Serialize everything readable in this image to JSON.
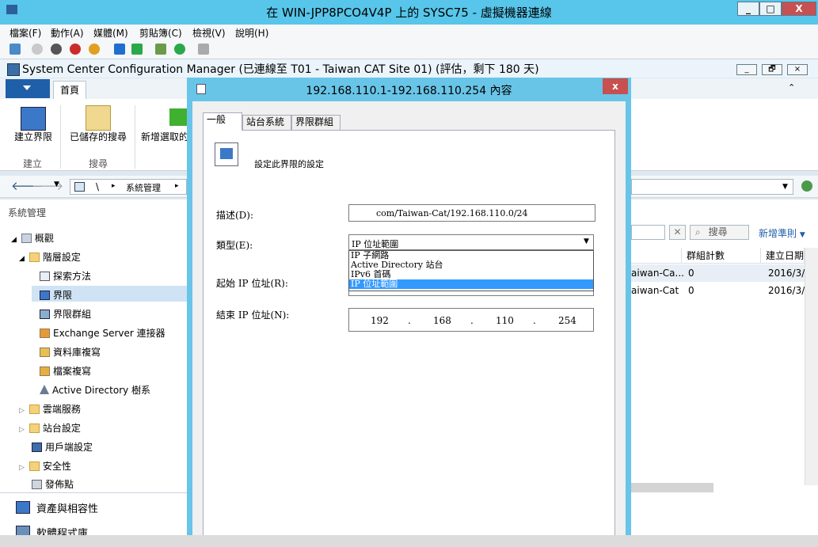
{
  "vm_window": {
    "title": "在 WIN-JPP8PCO4V4P 上的 SYSC75 - 虛擬機器連線",
    "menu": [
      "檔案(F)",
      "動作(A)",
      "媒體(M)",
      "剪貼簿(C)",
      "檢視(V)",
      "說明(H)"
    ],
    "minimize": "_",
    "maximize": "□",
    "close": "X"
  },
  "app": {
    "title": "System Center Configuration Manager (已連線至 T01 - Taiwan CAT Site 01) (評估，剩下 180 天)",
    "minimize": "_",
    "restore": "🗗",
    "close": "×"
  },
  "ribbon": {
    "home_tab": "首頁",
    "buttons": [
      "建立界限",
      "已儲存的搜尋",
      "新增選取的"
    ],
    "groups": [
      "建立",
      "搜尋"
    ]
  },
  "nav": {
    "breadcrumb": [
      "\\",
      "系統管理"
    ]
  },
  "sidebar": {
    "header": "系統管理",
    "items": [
      "概觀",
      "階層設定",
      "探索方法",
      "界限",
      "界限群組",
      "Exchange Server 連接器",
      "資料庫複寫",
      "檔案複寫",
      "Active Directory 樹系",
      "雲端服務",
      "站台設定",
      "用戶端設定",
      "安全性",
      "發佈點"
    ],
    "workspaces": [
      "資產與相容性",
      "軟體程式庫"
    ]
  },
  "content": {
    "search_label": "搜尋",
    "add_criteria": "新增準則",
    "columns": [
      "群組計數",
      "建立日期"
    ],
    "rows": [
      {
        "name": "aiwan-Ca...",
        "count": "0",
        "date": "2016/3/"
      },
      {
        "name": "aiwan-Cat",
        "count": "0",
        "date": "2016/3/"
      }
    ]
  },
  "dialog": {
    "title": "192.168.110.1-192.168.110.254 內容",
    "close": "x",
    "tabs": [
      "一般",
      "站台系統",
      "界限群組"
    ],
    "heading": "設定此界限的設定",
    "description_label": "描述(D):",
    "description_value": "com/Taiwan-Cat/192.168.110.0/24",
    "type_label": "類型(E):",
    "type_selected": "IP 位址範圍",
    "type_options": [
      "IP 子網路",
      "Active Directory 站台",
      "IPv6 首碼",
      "IP 位址範圍"
    ],
    "start_ip_label": "起始 IP 位址(R):",
    "end_ip_label": "結束 IP 位址(N):",
    "end_ip": [
      "192",
      "168",
      "110",
      "254"
    ],
    "ip_dot": "."
  },
  "colors": {
    "vm_title": "#57c6ea",
    "dialog_frame": "#68c5e8",
    "selection": "#3399ff",
    "close_red": "#c75050"
  }
}
